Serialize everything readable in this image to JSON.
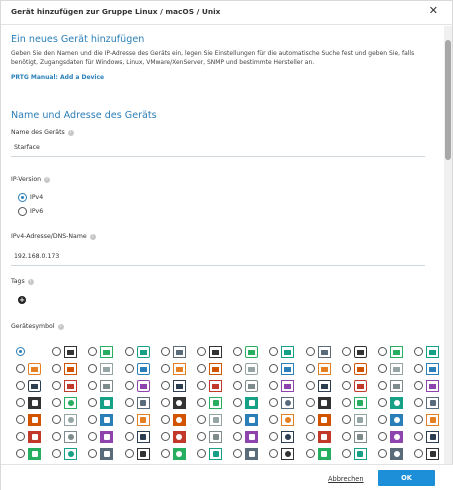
{
  "dialog": {
    "title": "Gerät hinzufügen zur Gruppe Linux / macOS / Unix",
    "close_icon": "close-icon"
  },
  "intro": {
    "heading": "Ein neues Gerät hinzufügen",
    "text": "Geben Sie den Namen und die IP-Adresse des Geräts ein, legen Sie Einstellungen für die automatische Suche fest und geben Sie, falls benötigt, Zugangsdaten für Windows, Linux, VMware/XenServer, SNMP und bestimmte Hersteller an.",
    "manual_link": "PRTG Manual: Add a Device"
  },
  "section": {
    "heading": "Name und Adresse des Geräts"
  },
  "device_name": {
    "label": "Name des Geräts",
    "value": "Starface"
  },
  "ip_version": {
    "label": "IP-Version",
    "options": [
      "IPv4",
      "IPv6"
    ],
    "selected": "IPv4"
  },
  "address": {
    "label": "IPv4-Adresse/DNS-Name",
    "value": "192.168.0.173"
  },
  "tags": {
    "label": "Tags",
    "add_icon": "plus-circle-icon"
  },
  "device_icon": {
    "label": "Gerätesymbol",
    "selected_index": 0,
    "rows": [
      [
        "none",
        "server",
        "rack-server",
        "tower",
        "two-disks",
        "doc",
        "printer-cloud",
        "monitor-alert",
        "notebook",
        "tablet",
        "linux-tux",
        "headset"
      ],
      [
        "apple",
        "mini-disk",
        "floppy",
        "chip",
        "tower-dark",
        "grid-server",
        "cube",
        "ssd",
        "router-box",
        "dotted-box",
        "tape",
        "laptop"
      ],
      [
        "graph",
        "nas",
        "globe",
        "shield",
        "fan",
        "cluster",
        "camera",
        "sd",
        "ethernet",
        "switch",
        "printer",
        "handheld"
      ],
      [
        "arrow-red",
        "cisco",
        "hp-ilo",
        "swirl",
        "dell-red",
        "apc",
        "usb",
        "apc-red",
        "apple-black",
        "c-red",
        "storage",
        "d-blue"
      ],
      [
        "emc",
        "x-red",
        "mac",
        "dash",
        "frame",
        "hp-logo",
        "bar-green",
        "huawei",
        "ibm",
        "juniper",
        "lenovo",
        "dot-blue"
      ],
      [
        "red-pair",
        "x-orange",
        "ring",
        "nexus",
        "box",
        "netapp",
        "shop",
        "x-black",
        "nutanix",
        "rac",
        "pure",
        "leaf"
      ],
      [
        "square-blue",
        "brand",
        "bar-dark",
        "ohd-red",
        "pulse",
        "vmware",
        "text-logo",
        "brand2",
        "square-black",
        "bar-gray",
        "veeam",
        "bolt"
      ]
    ]
  },
  "footer": {
    "cancel_label": "Abbrechen",
    "ok_label": "OK"
  },
  "colors": {
    "accent": "#2a7fb8",
    "ok_button": "#1d8fd8"
  }
}
